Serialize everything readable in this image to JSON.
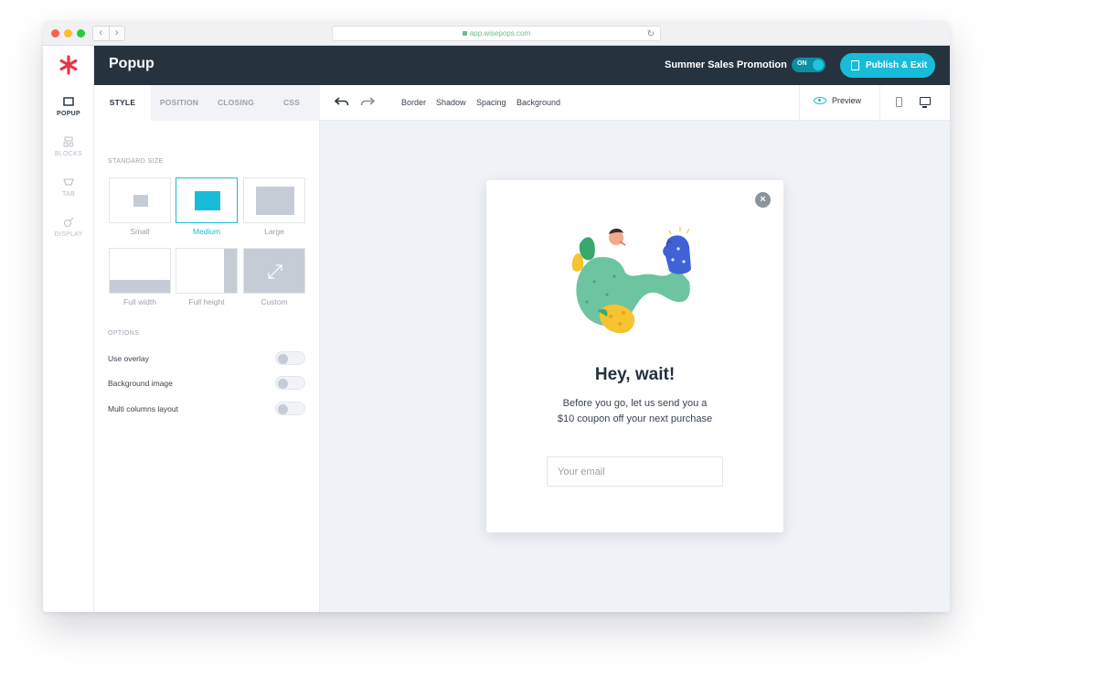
{
  "browser": {
    "url": "app.wisepops.com"
  },
  "header": {
    "title": "Popup",
    "campaign_name": "Summer Sales Promotion",
    "toggle_label": "ON",
    "publish_label": "Publish & Exit"
  },
  "rail": {
    "items": [
      {
        "label": "POPUP"
      },
      {
        "label": "BLOCKS"
      },
      {
        "label": "TAB"
      },
      {
        "label": "DISPLAY"
      }
    ]
  },
  "panel": {
    "tabs": [
      {
        "label": "STYLE"
      },
      {
        "label": "POSITION"
      },
      {
        "label": "CLOSING"
      },
      {
        "label": "CSS"
      }
    ],
    "standard_size_label": "STANDARD SIZE",
    "sizes": [
      {
        "label": "Small"
      },
      {
        "label": "Medium"
      },
      {
        "label": "Large"
      },
      {
        "label": "Full width"
      },
      {
        "label": "Full height"
      },
      {
        "label": "Custom"
      }
    ],
    "selected_size": "Medium",
    "options_label": "OPTIONS",
    "options": [
      {
        "label": "Use overlay",
        "enabled": false
      },
      {
        "label": "Background image",
        "enabled": false
      },
      {
        "label": "Multi columns layout",
        "enabled": false
      }
    ]
  },
  "toolbar": {
    "links": [
      {
        "label": "Border"
      },
      {
        "label": "Shadow"
      },
      {
        "label": "Spacing"
      },
      {
        "label": "Background"
      }
    ],
    "preview_label": "Preview"
  },
  "popup": {
    "heading": "Hey, wait!",
    "body_line1": "Before you go, let us send you a",
    "body_line2": "$10 coupon off your next purchase",
    "email_placeholder": "Your email"
  },
  "colors": {
    "accent": "#19bcd8",
    "header_bg": "#27323f",
    "canvas_bg": "#eff2f6",
    "logo": "#e8334a"
  }
}
